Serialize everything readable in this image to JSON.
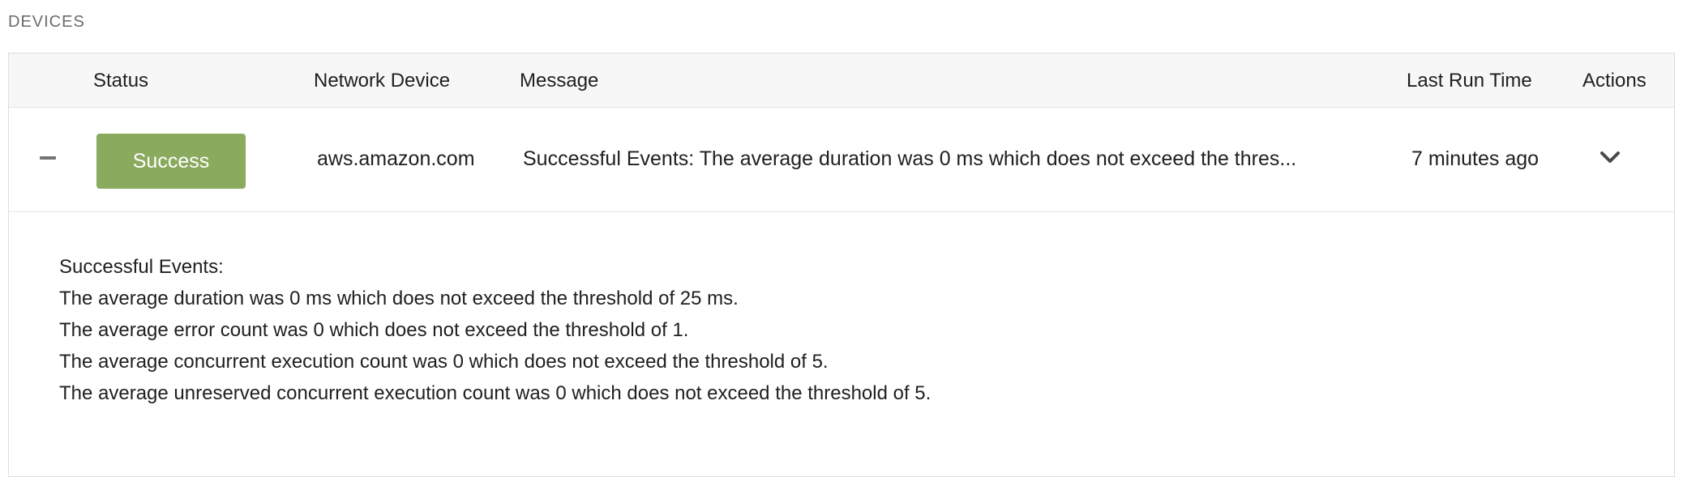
{
  "section": {
    "title": "DEVICES"
  },
  "table": {
    "headers": {
      "status": "Status",
      "device": "Network Device",
      "message": "Message",
      "last_run": "Last Run Time",
      "actions": "Actions"
    },
    "rows": [
      {
        "status": "Success",
        "device": "aws.amazon.com",
        "message": "Successful Events: The average duration was 0 ms which does not exceed the thres...",
        "last_run": "7 minutes ago",
        "expanded": true,
        "details": [
          "Successful Events:",
          "The average duration was 0 ms which does not exceed the threshold of 25 ms.",
          "The average error count was 0 which does not exceed the threshold of 1.",
          "The average concurrent execution count was 0 which does not exceed the threshold of 5.",
          "The average unreserved concurrent execution count was 0 which does not exceed the threshold of 5."
        ]
      }
    ]
  },
  "colors": {
    "success": "#8aaa5e",
    "header_bg": "#f7f7f7",
    "border": "#dedede",
    "muted_text": "#6b6b6b"
  },
  "icons": {
    "collapse": "minus-icon",
    "actions": "chevron-down-icon"
  }
}
